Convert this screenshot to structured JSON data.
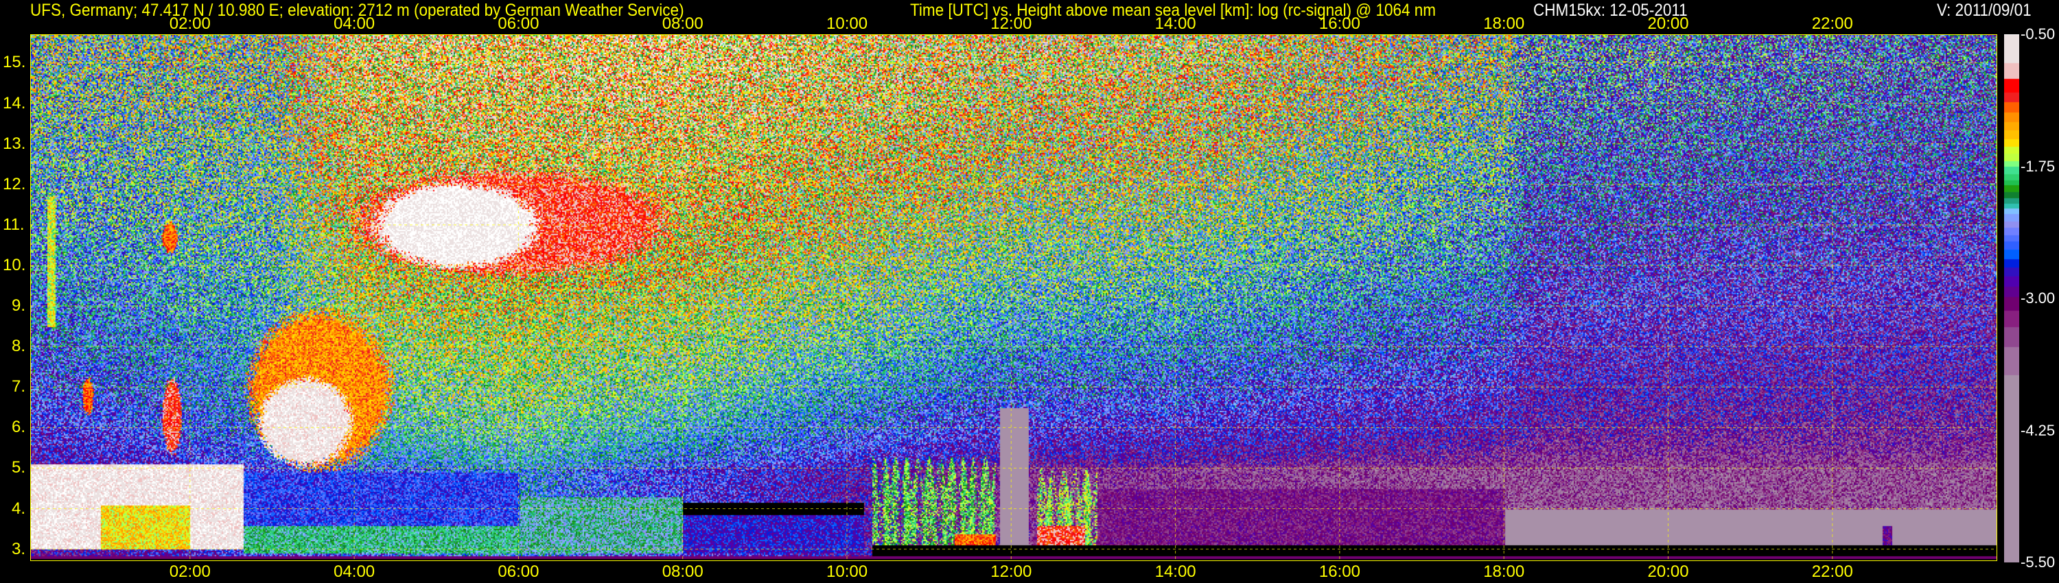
{
  "header": {
    "site_title": "UFS, Germany; 47.417 N / 10.980 E; elevation: 2712 m  (operated by German Weather Service)",
    "plot_title": "Time [UTC] vs. Height above mean sea level [km]: log (rc-signal) @ 1064 nm",
    "instrument_date": "CHM15kx: 12-05-2011",
    "version": "V: 2011/09/01"
  },
  "colors": {
    "text": "#ffff00",
    "frame": "#ffff00",
    "background": "#000000",
    "label_right": "#ffffff"
  },
  "chart_data": {
    "type": "heatmap",
    "title": "Time [UTC] vs. Height above mean sea level [km]: log (rc-signal) @ 1064 nm",
    "xlabel": "Time [UTC]",
    "ylabel": "Height above mean sea level [km]",
    "xlim": [
      0.07,
      24.0
    ],
    "ylim": [
      2.7,
      15.69
    ],
    "grid": true,
    "x_ticks": [
      "02:00",
      "04:00",
      "06:00",
      "08:00",
      "10:00",
      "12:00",
      "14:00",
      "16:00",
      "18:00",
      "20:00",
      "22:00"
    ],
    "x_tick_hours": [
      2,
      4,
      6,
      8,
      10,
      12,
      14,
      16,
      18,
      20,
      22
    ],
    "y_ticks": [
      "3.",
      "4.",
      "5.",
      "6.",
      "7.",
      "8.",
      "9.",
      "10.",
      "11.",
      "12.",
      "13.",
      "14.",
      "15."
    ],
    "y_tick_values": [
      3,
      4,
      5,
      6,
      7,
      8,
      9,
      10,
      11,
      12,
      13,
      14,
      15
    ],
    "colorbar": {
      "range": [
        -5.5,
        -0.5
      ],
      "tick_labels": [
        "-0.50",
        "-1.75",
        "-3.00",
        "-4.25",
        "-5.50"
      ],
      "tick_values": [
        -0.5,
        -1.75,
        -3.0,
        -4.25,
        -5.5
      ],
      "colorscale": [
        [
          "#ffffff",
          -0.5
        ],
        [
          "#ebe1e1",
          -0.77
        ],
        [
          "#f0c0c0",
          -0.92
        ],
        [
          "#ff0000",
          -1.05
        ],
        [
          "#f02020",
          -1.14
        ],
        [
          "#ff6000",
          -1.24
        ],
        [
          "#ff9000",
          -1.33
        ],
        [
          "#ffaa00",
          -1.41
        ],
        [
          "#ffc000",
          -1.49
        ],
        [
          "#ffe000",
          -1.56
        ],
        [
          "#d0ff30",
          -1.63
        ],
        [
          "#c0ff40",
          -1.7
        ],
        [
          "#80ff80",
          -1.75
        ],
        [
          "#40e090",
          -1.82
        ],
        [
          "#30d070",
          -1.88
        ],
        [
          "#20c050",
          -1.93
        ],
        [
          "#20a010",
          -1.99
        ],
        [
          "#108030",
          -2.05
        ],
        [
          "#20a080",
          -2.1
        ],
        [
          "#30c0b0",
          -2.15
        ],
        [
          "#80c0ff",
          -2.2
        ],
        [
          "#80a0ff",
          -2.27
        ],
        [
          "#9090f0",
          -2.33
        ],
        [
          "#7080ff",
          -2.4
        ],
        [
          "#5070ff",
          -2.46
        ],
        [
          "#3060ff",
          -2.54
        ],
        [
          "#0060ff",
          -2.63
        ],
        [
          "#0020e0",
          -2.71
        ],
        [
          "#3010c0",
          -2.79
        ],
        [
          "#5000b0",
          -2.89
        ],
        [
          "#600090",
          -2.99
        ],
        [
          "#700070",
          -3.12
        ],
        [
          "#882080",
          -3.27
        ],
        [
          "#904890",
          -3.46
        ],
        [
          "#a070a0",
          -3.73
        ],
        [
          "#a890a8",
          -4.18
        ]
      ]
    },
    "background_level": {
      "hours": [
        0,
        3,
        4,
        8,
        12,
        14,
        18,
        18.3,
        24
      ],
      "upper_15km": [
        -2.0,
        -1.9,
        -1.3,
        -1.2,
        -1.5,
        -1.5,
        -1.9,
        -2.3,
        -2.5
      ],
      "lower_5km_hours": [
        0,
        3,
        6,
        8,
        12,
        18,
        24
      ],
      "lower_5km": [
        -3.0,
        -2.6,
        -2.3,
        -2.6,
        -3.2,
        -3.4,
        -3.4
      ]
    },
    "features": [
      {
        "t": [
          0.05,
          2.65
        ],
        "h": [
          3.0,
          5.1
        ],
        "value": -0.6,
        "shape": "rect"
      },
      {
        "t": [
          0.9,
          2.0
        ],
        "h": [
          3.0,
          4.1
        ],
        "value": -1.5,
        "shape": "rect"
      },
      {
        "t": [
          0.25,
          0.35
        ],
        "h": [
          8.5,
          11.7
        ],
        "value": -1.6,
        "shape": "rect"
      },
      {
        "t": [
          0.68,
          0.82
        ],
        "h": [
          6.3,
          7.3
        ],
        "value": -1.2,
        "shape": "ellipse"
      },
      {
        "t": [
          1.65,
          1.85
        ],
        "h": [
          10.3,
          11.1
        ],
        "value": -1.2,
        "shape": "ellipse"
      },
      {
        "t": [
          1.65,
          1.9
        ],
        "h": [
          5.3,
          7.3
        ],
        "value": -1.0,
        "shape": "ellipse"
      },
      {
        "t": [
          2.65,
          4.5
        ],
        "h": [
          4.9,
          9.0
        ],
        "value": -1.3,
        "shape": "ellipse"
      },
      {
        "t": [
          2.8,
          4.0
        ],
        "h": [
          5.0,
          7.3
        ],
        "value": -0.6,
        "shape": "ellipse"
      },
      {
        "t": [
          3.9,
          7.9
        ],
        "h": [
          9.7,
          12.4
        ],
        "value": -1.0,
        "shape": "ellipse"
      },
      {
        "t": [
          4.2,
          6.3
        ],
        "h": [
          9.9,
          12.1
        ],
        "value": -0.5,
        "shape": "ellipse"
      },
      {
        "t": [
          2.65,
          6.0
        ],
        "h": [
          2.9,
          4.9
        ],
        "value": -2.6,
        "shape": "rect"
      },
      {
        "t": [
          2.65,
          8.0
        ],
        "h": [
          2.9,
          3.6
        ],
        "value": -2.0,
        "shape": "rect"
      },
      {
        "t": [
          6.0,
          8.0
        ],
        "h": [
          2.9,
          4.3
        ],
        "value": -2.1,
        "shape": "rect"
      },
      {
        "t": [
          8.0,
          10.2
        ],
        "h": [
          2.9,
          3.9
        ],
        "value": -2.75,
        "shape": "rect"
      },
      {
        "t": [
          8.0,
          10.2
        ],
        "h": [
          3.85,
          4.15
        ],
        "value": "none",
        "shape": "rect"
      },
      {
        "t": [
          10.3,
          11.8
        ],
        "h": [
          3.1,
          5.3
        ],
        "value": -1.8,
        "shape": "columns"
      },
      {
        "t": [
          11.3,
          11.8
        ],
        "h": [
          3.0,
          3.4
        ],
        "value": -1.2,
        "shape": "rect"
      },
      {
        "t": [
          11.85,
          12.2
        ],
        "h": [
          3.0,
          6.5
        ],
        "value": -4.3,
        "shape": "rect"
      },
      {
        "t": [
          12.3,
          13.05
        ],
        "h": [
          3.0,
          5.0
        ],
        "value": -1.7,
        "shape": "columns"
      },
      {
        "t": [
          12.3,
          12.9
        ],
        "h": [
          3.0,
          3.6
        ],
        "value": -1.0,
        "shape": "rect"
      },
      {
        "t": [
          13.05,
          18.0
        ],
        "h": [
          3.1,
          4.5
        ],
        "value": -3.1,
        "shape": "rect"
      },
      {
        "t": [
          18.0,
          24.0
        ],
        "h": [
          3.1,
          4.0
        ],
        "value": -4.6,
        "shape": "rect"
      },
      {
        "t": [
          22.6,
          22.72
        ],
        "h": [
          3.1,
          3.6
        ],
        "value": -3.0,
        "shape": "rect"
      },
      {
        "t": [
          10.3,
          24.0
        ],
        "h": [
          2.85,
          3.1
        ],
        "value": "none",
        "shape": "rect"
      }
    ]
  }
}
